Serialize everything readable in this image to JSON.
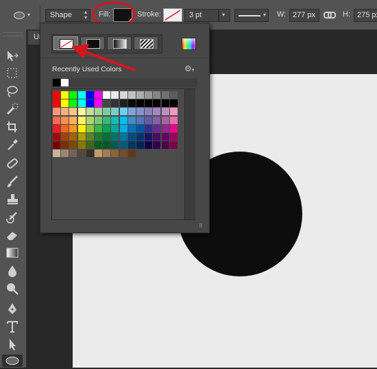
{
  "options_bar": {
    "tool_mode": "Shape",
    "fill_label": "Fill:",
    "fill_color": "#111111",
    "stroke_label": "Stroke:",
    "stroke_width": "3 pt",
    "width_label": "W:",
    "width_value": "277 px",
    "height_label": "H:",
    "height_value": "275 px"
  },
  "document_tab": {
    "title": "Ur"
  },
  "popover": {
    "recent_title": "Recently Used Colors",
    "recent_colors": [
      "#000000",
      "#ffffff"
    ],
    "fill_types": [
      "no-color",
      "solid-color",
      "gradient",
      "pattern"
    ],
    "swatch_rows": [
      [
        "#ff0000",
        "#ffff00",
        "#00ff00",
        "#00ffff",
        "#0000ff",
        "#ff00ff",
        "#ffffff",
        "#ebebeb",
        "#d6d6d6",
        "#c2c2c2",
        "#adadad",
        "#999999",
        "#858585",
        "#707070",
        "#5c5c5c"
      ],
      [
        "#ff0000",
        "#ffff00",
        "#00ff00",
        "#00ffff",
        "#0000ff",
        "#ff00ff",
        "#474747",
        "#333333",
        "#1f1f1f",
        "#0a0a0a",
        "#000000",
        "#000000",
        "#000000",
        "#000000",
        "#000000"
      ],
      [
        "#f7977a",
        "#f9ad81",
        "#fdc68a",
        "#fff79a",
        "#c4df9b",
        "#a2d39c",
        "#82ca9d",
        "#7bcdc8",
        "#6ecff6",
        "#7ea7d8",
        "#8493ca",
        "#8882be",
        "#a187be",
        "#bc8dbf",
        "#f49ac2"
      ],
      [
        "#f26c4f",
        "#f68e55",
        "#fbaf5c",
        "#fff467",
        "#acd372",
        "#7cc576",
        "#3bb878",
        "#1abbb4",
        "#00bff3",
        "#438cca",
        "#5574b9",
        "#605ca8",
        "#855fa8",
        "#a763a8",
        "#f06ea9"
      ],
      [
        "#ed1c24",
        "#f26522",
        "#f7941d",
        "#fff200",
        "#8dc73f",
        "#39b54a",
        "#00a651",
        "#00a99d",
        "#00aeef",
        "#0072bc",
        "#0054a6",
        "#2e3192",
        "#662d91",
        "#92278f",
        "#ec008c"
      ],
      [
        "#9e0b0f",
        "#a0410d",
        "#a36209",
        "#aba000",
        "#598527",
        "#1a7b30",
        "#007236",
        "#00746b",
        "#0076a3",
        "#004b80",
        "#003471",
        "#1b1464",
        "#440e62",
        "#630460",
        "#9e005d"
      ],
      [
        "#790000",
        "#7b2e00",
        "#7d4900",
        "#827b00",
        "#406618",
        "#005e20",
        "#005826",
        "#005952",
        "#005b7f",
        "#003663",
        "#002157",
        "#0d004c",
        "#32004b",
        "#4b0049",
        "#7b0046"
      ],
      [
        "#c7b299",
        "#998675",
        "#736357",
        "#534741",
        "#37302d",
        "#c69c6d",
        "#a67c52",
        "#8c6239",
        "#754c24",
        "#603913"
      ]
    ]
  }
}
